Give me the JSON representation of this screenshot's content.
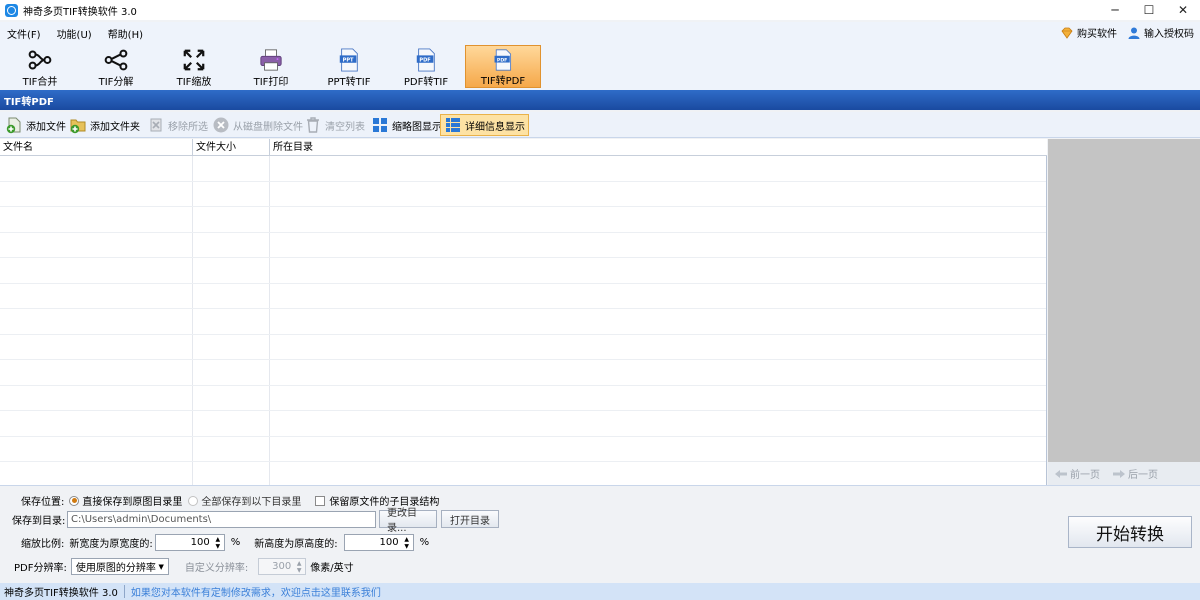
{
  "window": {
    "title": "神奇多页TIF转换软件 3.0",
    "controls": [
      "─",
      "☐",
      "✕"
    ]
  },
  "menu": {
    "items": [
      "文件(F)",
      "功能(U)",
      "帮助(H)"
    ],
    "buy": "购买软件",
    "license": "输入授权码"
  },
  "toolbar": {
    "tools": [
      {
        "label": "TIF合并",
        "icon": "merge-icon"
      },
      {
        "label": "TIF分解",
        "icon": "split-icon"
      },
      {
        "label": "TIF缩放",
        "icon": "zoom-icon"
      },
      {
        "label": "TIF打印",
        "icon": "printer-icon"
      },
      {
        "label": "PPT转TIF",
        "icon": "ppt-file-icon"
      },
      {
        "label": "PDF转TIF",
        "icon": "pdf-file-icon"
      },
      {
        "label": "TIF转PDF",
        "icon": "pdf-file-icon",
        "active": true
      }
    ]
  },
  "section": {
    "title": "TIF转PDF"
  },
  "actions": {
    "add_file": "添加文件",
    "add_folder": "添加文件夹",
    "remove_selected": "移除所选",
    "delete_from_disk": "从磁盘删除文件",
    "clear_list": "清空列表",
    "thumbnail_view": "缩略图显示",
    "detail_view": "详细信息显示"
  },
  "table": {
    "columns": [
      "文件名",
      "文件大小",
      "所在目录"
    ],
    "rows": []
  },
  "preview": {
    "prev": "前一页",
    "next": "后一页"
  },
  "settings": {
    "save_location_label": "保存位置:",
    "option_original": "直接保存到原图目录里",
    "option_all": "全部保存到以下目录里",
    "keep_structure": "保留原文件的子目录结构",
    "save_dir_label": "保存到目录:",
    "save_dir_value": "C:\\Users\\admin\\Documents\\",
    "change_dir": "更改目录...",
    "open_dir": "打开目录",
    "scale_label": "缩放比例:",
    "width_label": "新宽度为原宽度的:",
    "width_value": "100",
    "height_label": "新高度为原高度的:",
    "height_value": "100",
    "percent": "%",
    "resolution_label": "PDF分辨率:",
    "resolution_option": "使用原图的分辨率",
    "custom_res_label": "自定义分辨率:",
    "custom_res_value": "300",
    "dpi_unit": "像素/英寸",
    "start": "开始转换"
  },
  "status": {
    "title": "神奇多页TIF转换软件 3.0",
    "message": "如果您对本软件有定制修改需求，欢迎点击这里联系我们"
  },
  "colors": {
    "header_blue": "#1a4aa0",
    "active_orange": "#f5a84a",
    "link_blue": "#3a7fd8"
  }
}
